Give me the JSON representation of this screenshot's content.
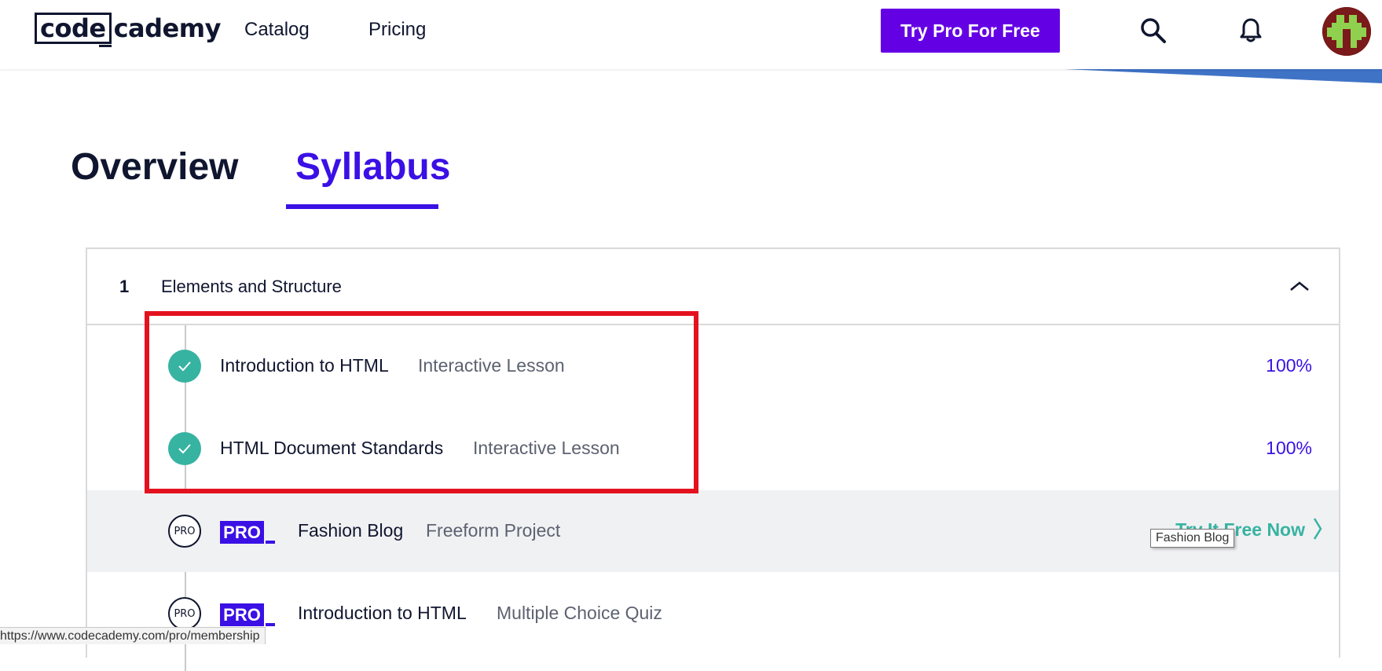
{
  "header": {
    "logo": {
      "part1": "code",
      "part2": "cademy"
    },
    "nav": [
      "Catalog",
      "Pricing"
    ],
    "cta_label": "Try Pro For Free",
    "icons": [
      "search-icon",
      "bell-icon",
      "avatar"
    ]
  },
  "tabs": [
    {
      "label": "Overview",
      "active": false
    },
    {
      "label": "Syllabus",
      "active": true
    }
  ],
  "module": {
    "number": "1",
    "title": "Elements and Structure",
    "expanded": true
  },
  "lessons": [
    {
      "title": "Introduction to HTML",
      "type": "Interactive Lesson",
      "status": "complete",
      "progress": "100%"
    },
    {
      "title": "HTML Document Standards",
      "type": "Interactive Lesson",
      "status": "complete",
      "progress": "100%"
    },
    {
      "marker": "PRO",
      "badge": "PRO",
      "title": "Fashion Blog",
      "type": "Freeform Project",
      "cta": "Try It Free Now",
      "tooltip": "Fashion Blog"
    },
    {
      "marker": "PRO",
      "badge": "PRO",
      "title": "Introduction to HTML",
      "type": "Multiple Choice Quiz"
    }
  ],
  "status_url": "https://www.codecademy.com/pro/membership",
  "colors": {
    "brand_purple": "#6400e4",
    "accent_blue": "#3a10e5",
    "complete_teal": "#37b3a1",
    "annotation_red": "#e3121e",
    "navy": "#10162f"
  }
}
